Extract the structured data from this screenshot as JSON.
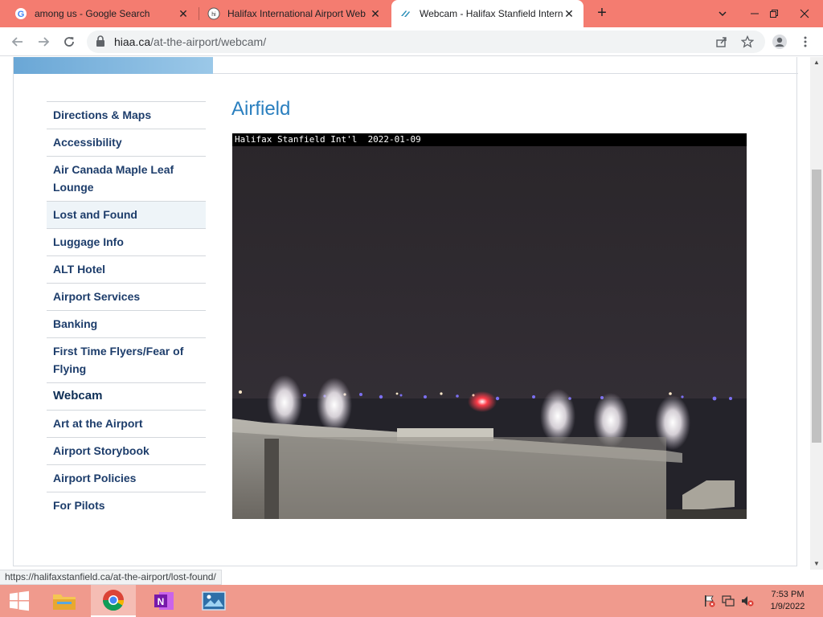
{
  "browser": {
    "tabs": [
      {
        "title": "among us - Google Search",
        "icon": "google-icon"
      },
      {
        "title": "Halifax International Airport Web",
        "icon": "hiaa-icon"
      },
      {
        "title": "Webcam - Halifax Stanfield Intern",
        "icon": "hiaa-wave-icon",
        "active": true
      }
    ],
    "new_tab": "+",
    "url_host": "hiaa.ca",
    "url_path": "/at-the-airport/webcam/"
  },
  "page": {
    "section_title": "Airfield",
    "nav_items": [
      "Directions & Maps",
      "Accessibility",
      "Air Canada Maple Leaf Lounge",
      "Lost and Found",
      "Luggage Info",
      "ALT Hotel",
      "Airport Services",
      "Banking",
      "First Time Flyers/Fear of Flying",
      "Webcam",
      "Art at the Airport",
      "Airport Storybook",
      "Airport Policies",
      "For Pilots"
    ],
    "webcam_caption": "Halifax Stanfield Int'l  2022-01-09"
  },
  "status_url": "https://halifaxstanfield.ca/at-the-airport/lost-found/",
  "taskbar": {
    "apps": [
      "start-icon",
      "file-explorer-icon",
      "chrome-icon",
      "onenote-icon",
      "photos-icon"
    ],
    "clock_time": "7:53 PM",
    "clock_date": "1/9/2022"
  },
  "colors": {
    "tabstrip": "#f47c70",
    "taskbar": "#f09a8d",
    "heading_blue": "#2a7fbf",
    "nav_text": "#1d3d6b"
  }
}
